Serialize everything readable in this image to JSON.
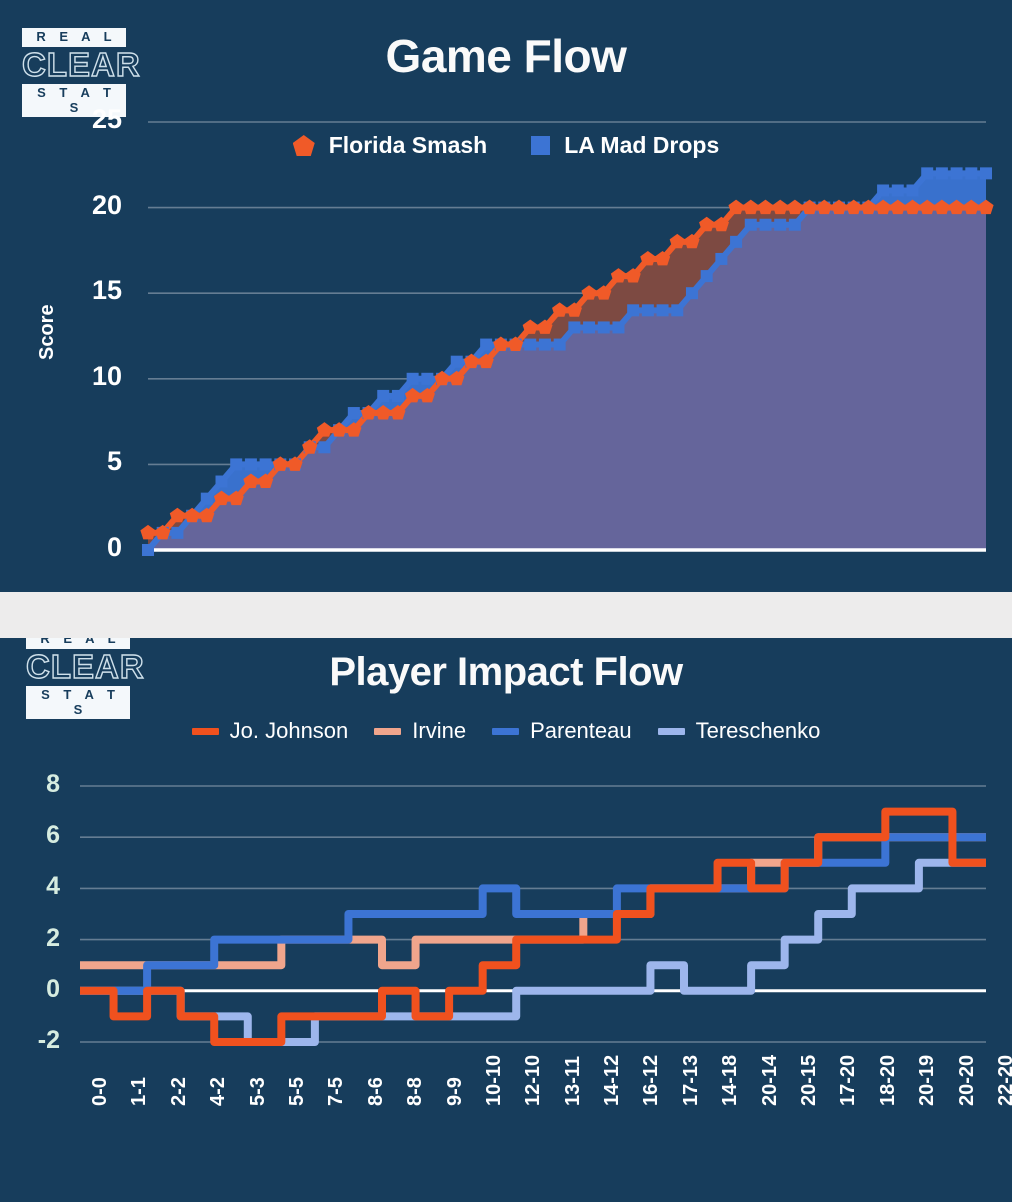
{
  "logo": {
    "top": "R E A L",
    "middle": "CLEAR",
    "bottom": "S T A T S",
    "name": "real-clear-stats-logo"
  },
  "colors": {
    "panel_background": "#173d5c",
    "page_background": "#edecec",
    "florida_orange": "#f05a28",
    "la_blue": "#3c74d4",
    "irvine_salmon": "#f0a58c",
    "tereschenko_lightblue": "#9db6ec",
    "grid": "#7f93a6",
    "baseline": "#ffffff",
    "axis_label_chart2": "#d6ece0",
    "fill_orange_over_blue": "#7d4a42",
    "fill_blue_area": "#65659b"
  },
  "panels": [
    {
      "id": "game-flow",
      "title": "Game Flow",
      "legend": [
        {
          "label": "Florida Smash",
          "marker": "pentagon",
          "color": "#f05a28"
        },
        {
          "label": "LA Mad Drops",
          "marker": "square",
          "color": "#3c74d4"
        }
      ]
    },
    {
      "id": "player-impact",
      "title": "Player Impact Flow",
      "legend": [
        {
          "label": "Jo. Johnson",
          "marker": "line",
          "color": "#f0511e"
        },
        {
          "label": "Irvine",
          "marker": "line",
          "color": "#f0a58c"
        },
        {
          "label": "Parenteau",
          "marker": "line",
          "color": "#3c74d4"
        },
        {
          "label": "Tereschenko",
          "marker": "line",
          "color": "#9db6ec"
        }
      ]
    }
  ],
  "chart_data": [
    {
      "type": "line",
      "id": "game-flow",
      "title": "Game Flow",
      "xlabel": "",
      "ylabel": "Score",
      "ylim": [
        0,
        25
      ],
      "yticks": [
        0,
        5,
        10,
        15,
        20,
        25
      ],
      "grid": true,
      "legend_position": "top-center",
      "markers": {
        "Florida Smash": "pentagon",
        "LA Mad Drops": "square"
      },
      "x": [
        0,
        1,
        2,
        3,
        4,
        5,
        6,
        7,
        8,
        9,
        10,
        11,
        12,
        13,
        14,
        15,
        16,
        17,
        18,
        19,
        20,
        21,
        22,
        23,
        24,
        25,
        26,
        27,
        28,
        29,
        30,
        31,
        32,
        33,
        34,
        35,
        36,
        37,
        38,
        39,
        40,
        41,
        42,
        43,
        44,
        45,
        46,
        47,
        48,
        49,
        50,
        51,
        52,
        53,
        54,
        55,
        56,
        57
      ],
      "series": [
        {
          "name": "Florida Smash",
          "color": "#f05a28",
          "values": [
            1,
            1,
            2,
            2,
            2,
            3,
            3,
            4,
            4,
            5,
            5,
            6,
            7,
            7,
            7,
            8,
            8,
            8,
            9,
            9,
            10,
            10,
            11,
            11,
            12,
            12,
            13,
            13,
            14,
            14,
            15,
            15,
            16,
            16,
            17,
            17,
            18,
            18,
            19,
            19,
            20,
            20,
            20,
            20,
            20,
            20,
            20,
            20,
            20,
            20,
            20,
            20,
            20,
            20,
            20,
            20,
            20,
            20
          ]
        },
        {
          "name": "LA Mad Drops",
          "color": "#3c74d4",
          "values": [
            0,
            1,
            1,
            2,
            3,
            4,
            5,
            5,
            5,
            5,
            5,
            6,
            6,
            7,
            8,
            8,
            9,
            9,
            10,
            10,
            10,
            11,
            11,
            12,
            12,
            12,
            12,
            12,
            12,
            13,
            13,
            13,
            13,
            14,
            14,
            14,
            14,
            15,
            16,
            17,
            18,
            19,
            19,
            19,
            19,
            20,
            20,
            20,
            20,
            20,
            21,
            21,
            21,
            22,
            22,
            22,
            22,
            22
          ]
        }
      ]
    },
    {
      "type": "line",
      "id": "player-impact",
      "title": "Player Impact Flow",
      "xlabel": "",
      "ylabel": "",
      "ylim": [
        -2,
        8
      ],
      "yticks": [
        -2,
        0,
        2,
        4,
        6,
        8
      ],
      "grid": true,
      "legend_position": "top-center",
      "categories": [
        "0-0",
        "1-1",
        "2-2",
        "4-2",
        "5-3",
        "5-5",
        "7-5",
        "8-6",
        "8-8",
        "9-9",
        "10-10",
        "12-10",
        "13-11",
        "14-12",
        "16-12",
        "17-13",
        "14-18",
        "20-14",
        "20-15",
        "17-20",
        "18-20",
        "20-19",
        "20-20",
        "22-20"
      ],
      "series": [
        {
          "name": "Jo. Johnson",
          "color": "#f0511e",
          "values": [
            0,
            -1,
            0,
            -1,
            -2,
            -2,
            -1,
            -1,
            -1,
            0,
            -1,
            0,
            1,
            2,
            2,
            2,
            3,
            4,
            4,
            5,
            4,
            5,
            6,
            6,
            7,
            7,
            5,
            5
          ]
        },
        {
          "name": "Irvine",
          "color": "#f0a58c",
          "values": [
            1,
            1,
            1,
            1,
            1,
            1,
            2,
            2,
            2,
            1,
            2,
            2,
            2,
            2,
            2,
            3,
            3,
            4,
            4,
            4,
            5,
            5,
            6,
            6,
            6,
            6,
            6,
            6
          ]
        },
        {
          "name": "Parenteau",
          "color": "#3c74d4",
          "values": [
            0,
            0,
            1,
            1,
            2,
            2,
            2,
            2,
            3,
            3,
            3,
            3,
            4,
            3,
            3,
            3,
            4,
            4,
            4,
            4,
            4,
            5,
            5,
            5,
            6,
            6,
            6,
            6
          ]
        },
        {
          "name": "Tereschenko",
          "color": "#9db6ec",
          "values": [
            0,
            0,
            0,
            -1,
            -1,
            -2,
            -2,
            -1,
            -1,
            -1,
            -1,
            -1,
            -1,
            0,
            0,
            0,
            0,
            1,
            0,
            0,
            1,
            2,
            3,
            4,
            4,
            5,
            5,
            5
          ]
        }
      ]
    }
  ],
  "yaxis_game_flow": [
    "25",
    "20",
    "15",
    "10",
    "5",
    "0"
  ],
  "yaxis_label_game_flow": "Score",
  "yaxis_player_impact": [
    "8",
    "6",
    "4",
    "2",
    "0",
    "-2"
  ],
  "xaxis_player_impact": [
    "0-0",
    "1-1",
    "2-2",
    "4-2",
    "5-3",
    "5-5",
    "7-5",
    "8-6",
    "8-8",
    "9-9",
    "10-10",
    "12-10",
    "13-11",
    "14-12",
    "16-12",
    "17-13",
    "14-18",
    "20-14",
    "20-15",
    "17-20",
    "18-20",
    "20-19",
    "20-20",
    "22-20"
  ]
}
